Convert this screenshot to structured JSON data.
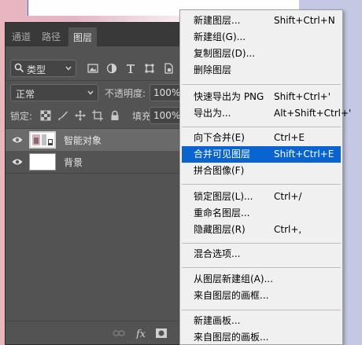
{
  "panel": {
    "tabs": [
      "通道",
      "路径",
      "图层"
    ],
    "active_tab": "图层",
    "filter": {
      "value": "类型"
    },
    "blend_mode": "正常",
    "opacity_label": "不透明度:",
    "opacity_value": "100%",
    "lock_label": "锁定:",
    "fill_label": "填充:",
    "fill_value": "100%",
    "layers": [
      {
        "name": "智能对象",
        "selected": true,
        "visible": true,
        "type": "smart-object"
      },
      {
        "name": "背景",
        "selected": false,
        "visible": true,
        "type": "background"
      }
    ],
    "bottom_icons": [
      "link-icon",
      "fx-icon",
      "mask-icon"
    ]
  },
  "menu": {
    "items": [
      {
        "label": "新建图层...",
        "shortcut": "Shift+Ctrl+N"
      },
      {
        "label": "新建组(G)...",
        "shortcut": ""
      },
      {
        "label": "复制图层(D)...",
        "shortcut": ""
      },
      {
        "label": "删除图层",
        "shortcut": ""
      },
      {
        "label": "快速导出为 PNG",
        "shortcut": "Shift+Ctrl+'"
      },
      {
        "label": "导出为...",
        "shortcut": "Alt+Shift+Ctrl+'"
      },
      {
        "label": "向下合并(E)",
        "shortcut": "Ctrl+E"
      },
      {
        "label": "合并可见图层",
        "shortcut": "Shift+Ctrl+E",
        "highlighted": true
      },
      {
        "label": "拼合图像(F)",
        "shortcut": ""
      },
      {
        "label": "锁定图层(L)...",
        "shortcut": "Ctrl+/"
      },
      {
        "label": "重命名图层...",
        "shortcut": ""
      },
      {
        "label": "隐藏图层(R)",
        "shortcut": "Ctrl+,"
      },
      {
        "label": "混合选项...",
        "shortcut": ""
      },
      {
        "label": "从图层新建组(A)...",
        "shortcut": ""
      },
      {
        "label": "来自图层的画框...",
        "shortcut": ""
      },
      {
        "label": "新建画板...",
        "shortcut": ""
      },
      {
        "label": "来自图层的画板...",
        "shortcut": ""
      }
    ]
  },
  "colors": {
    "panel_bg": "#535353",
    "tabbar_bg": "#393939",
    "menu_bg": "#f0f0f0",
    "menu_highlight": "#0a64d0"
  }
}
